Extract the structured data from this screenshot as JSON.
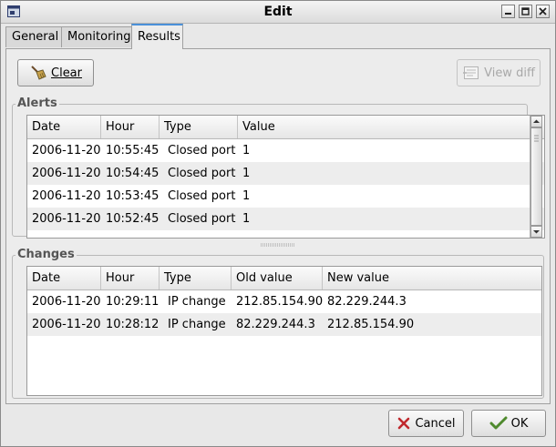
{
  "window": {
    "title": "Edit",
    "controls": [
      "minimize",
      "maximize",
      "close"
    ]
  },
  "tabs": [
    {
      "label": "General",
      "active": false
    },
    {
      "label": "Monitoring",
      "active": false
    },
    {
      "label": "Results",
      "active": true
    }
  ],
  "toolbar": {
    "clear_label": "Clear",
    "view_diff_label": "View diff",
    "view_diff_enabled": false
  },
  "alerts": {
    "title": "Alerts",
    "columns": [
      "Date",
      "Hour",
      "Type",
      "Value"
    ],
    "rows": [
      {
        "date": "2006-11-20",
        "hour": "10:55:45",
        "type": "Closed port",
        "value": "1"
      },
      {
        "date": "2006-11-20",
        "hour": "10:54:45",
        "type": "Closed port",
        "value": "1"
      },
      {
        "date": "2006-11-20",
        "hour": "10:53:45",
        "type": "Closed port",
        "value": "1"
      },
      {
        "date": "2006-11-20",
        "hour": "10:52:45",
        "type": "Closed port",
        "value": "1"
      }
    ]
  },
  "changes": {
    "title": "Changes",
    "columns": [
      "Date",
      "Hour",
      "Type",
      "Old value",
      "New value"
    ],
    "rows": [
      {
        "date": "2006-11-20",
        "hour": "10:29:11",
        "type": "IP change",
        "old": "212.85.154.90",
        "new": "82.229.244.3"
      },
      {
        "date": "2006-11-20",
        "hour": "10:28:12",
        "type": "IP change",
        "old": "82.229.244.3",
        "new": "212.85.154.90"
      }
    ]
  },
  "footer": {
    "cancel_label": "Cancel",
    "ok_label": "OK"
  },
  "colors": {
    "tab_accent": "#4a90d9",
    "cancel_icon": "#c0282d",
    "ok_icon": "#4f8a2e"
  }
}
